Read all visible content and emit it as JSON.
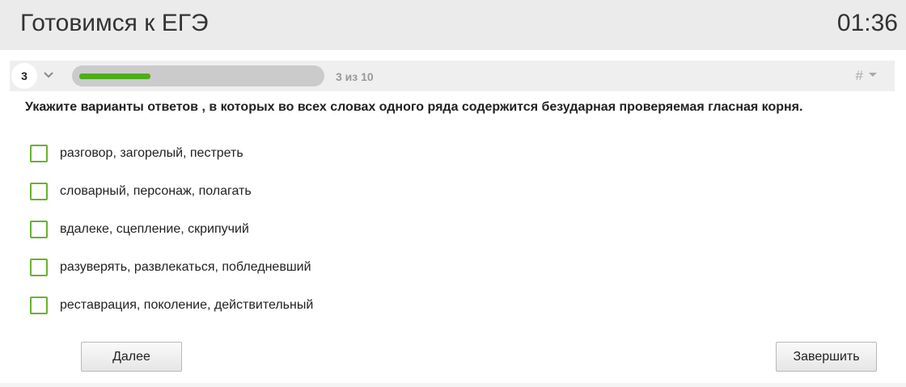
{
  "header": {
    "title": "Готовимся к ЕГЭ",
    "timer": "01:36"
  },
  "question_bar": {
    "number": "3",
    "progress_text": "3 из 10",
    "progress_fraction": 0.3,
    "progress_color": "#4caf1a",
    "hash_label": "#"
  },
  "question": {
    "text": "Укажите варианты ответов , в которых во всех словах одного ряда содержится безударная проверяемая гласная корня."
  },
  "options": [
    {
      "label": "разговор, загорелый, пестреть",
      "checked": false
    },
    {
      "label": "словарный, персонаж, полагать",
      "checked": false
    },
    {
      "label": "вдалеке, сцепление, скрипучий",
      "checked": false
    },
    {
      "label": "разуверять, развлекаться, поблedневший",
      "checked": false
    },
    {
      "label": "реставрация, поколение, действительный",
      "checked": false
    }
  ],
  "buttons": {
    "next_label": "Далее",
    "finish_label": "Завершить"
  },
  "colors": {
    "checkbox_border": "#66b32e",
    "header_bg": "#ebebeb"
  }
}
